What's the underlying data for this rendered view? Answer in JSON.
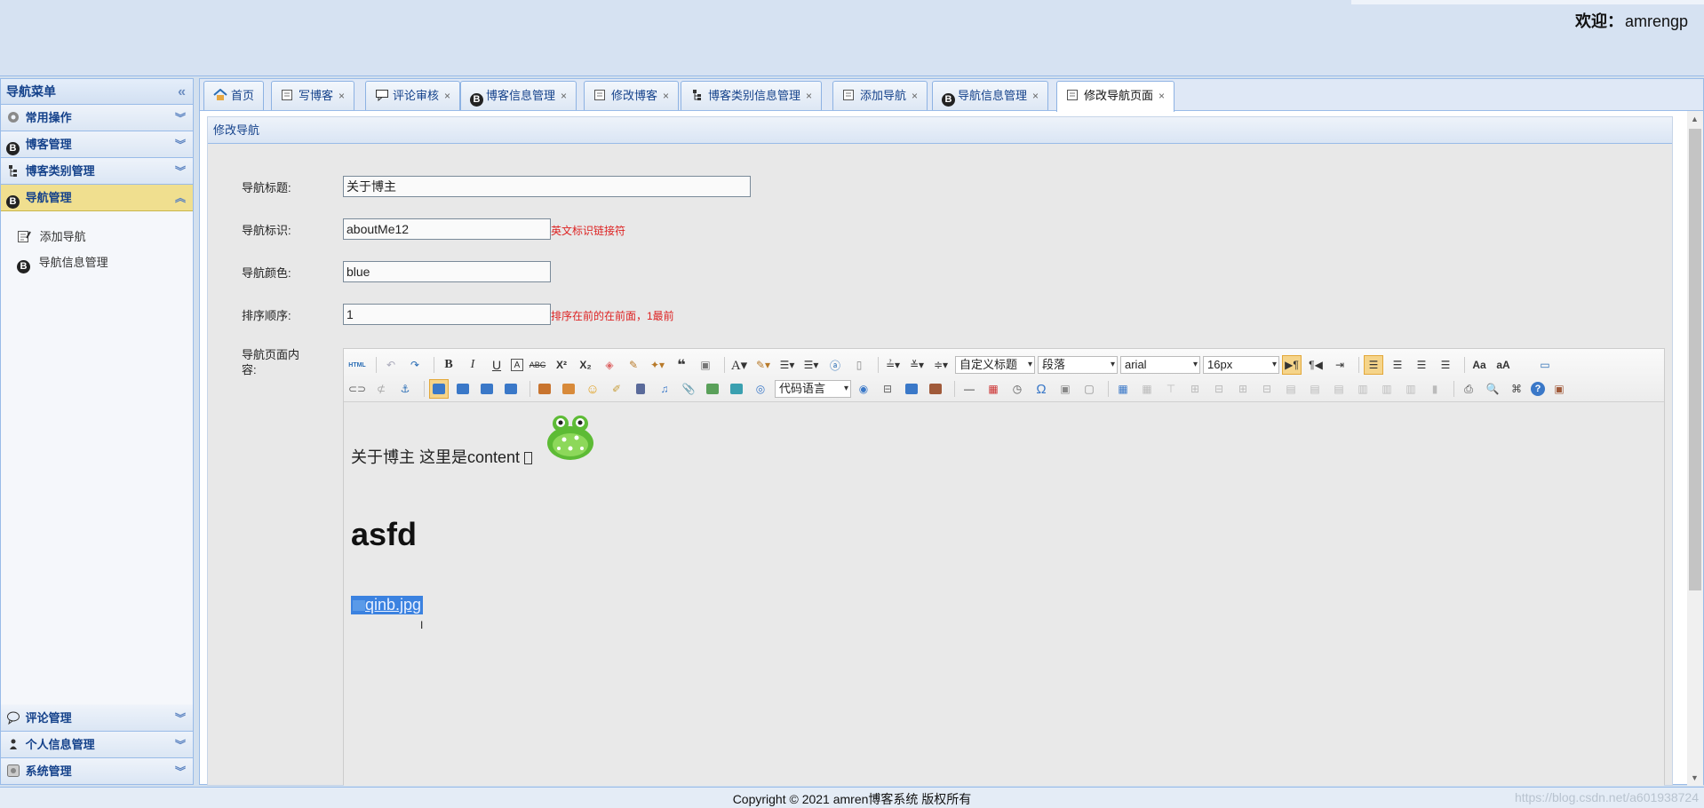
{
  "header": {
    "welcome_label": "欢迎：",
    "username": "amrengp"
  },
  "sidebar": {
    "title": "导航菜单",
    "sections": [
      {
        "label": "常用操作"
      },
      {
        "label": "博客管理"
      },
      {
        "label": "博客类别管理"
      },
      {
        "label": "导航管理"
      }
    ],
    "active_items": [
      {
        "label": "添加导航"
      },
      {
        "label": "导航信息管理"
      }
    ],
    "bottom_sections": [
      {
        "label": "评论管理"
      },
      {
        "label": "个人信息管理"
      },
      {
        "label": "系统管理"
      }
    ]
  },
  "tabs": [
    {
      "label": "首页"
    },
    {
      "label": "写博客"
    },
    {
      "label": "评论审核"
    },
    {
      "label": "博客信息管理"
    },
    {
      "label": "修改博客"
    },
    {
      "label": "博客类别信息管理"
    },
    {
      "label": "添加导航"
    },
    {
      "label": "导航信息管理"
    },
    {
      "label": "修改导航页面"
    }
  ],
  "panel": {
    "title": "修改导航"
  },
  "form": {
    "title_label": "导航标题:",
    "title_value": "关于博主",
    "ident_label": "导航标识:",
    "ident_value": "aboutMe12",
    "ident_hint": "英文标识链接符",
    "color_label": "导航颜色:",
    "color_value": "blue",
    "order_label": "排序顺序:",
    "order_value": "1",
    "order_hint": "排序在前的在前面，1最前",
    "content_label": "导航页面内容:"
  },
  "editor": {
    "style_select": "自定义标题",
    "paragraph_select": "段落",
    "font_select": "arial",
    "size_select": "16px",
    "code_select": "代码语言",
    "html_btn": "HTML",
    "content_line1": "关于博主 这里是content ",
    "content_heading": "asfd",
    "content_link": "qinb.jpg"
  },
  "footer": {
    "copyright": "Copyright © 2021 amren博客系统 版权所有",
    "watermark": "https://blog.csdn.net/a601938724"
  }
}
